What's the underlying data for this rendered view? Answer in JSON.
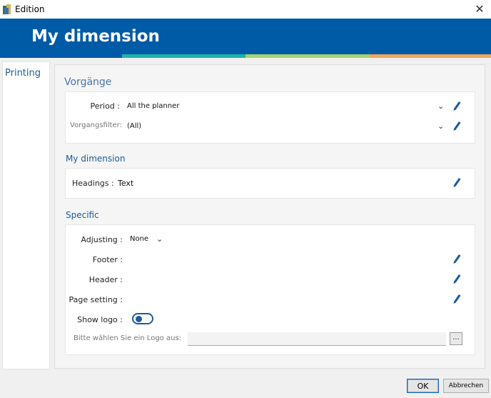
{
  "window": {
    "title": "Edition",
    "close_glyph": "✕"
  },
  "banner": {
    "title": "My dimension"
  },
  "nav": {
    "items": [
      {
        "label": "Printing"
      }
    ]
  },
  "sections": {
    "vorgaenge": {
      "title": "Vorgänge",
      "period_label": "Period :",
      "period_value": "All the planner",
      "filter_label": "Vorgangsfilter:",
      "filter_value": "(All)"
    },
    "my_dimension": {
      "title": "My dimension",
      "headings_label": "Headings :",
      "headings_value": "Text"
    },
    "specific": {
      "title": "Specific",
      "adjusting_label": "Adjusting :",
      "adjusting_value": "None",
      "footer_label": "Footer :",
      "header_label": "Header :",
      "page_setting_label": "Page setting :",
      "show_logo_label": "Show logo :",
      "show_logo_on": true,
      "logo_label": "Bitte wählen Sie ein Logo aus:",
      "logo_value": "",
      "browse_label": "..."
    }
  },
  "icons": {
    "edit": "pencil-icon",
    "dropdown": "chevron-down-icon"
  },
  "colors": {
    "brand": "#005ba6",
    "accent_teal": "#1db4a6",
    "accent_green": "#a8d36c",
    "accent_orange": "#f2a65a",
    "link": "#1d5c96"
  },
  "buttons": {
    "ok": "OK",
    "cancel": "Abbrechen"
  }
}
